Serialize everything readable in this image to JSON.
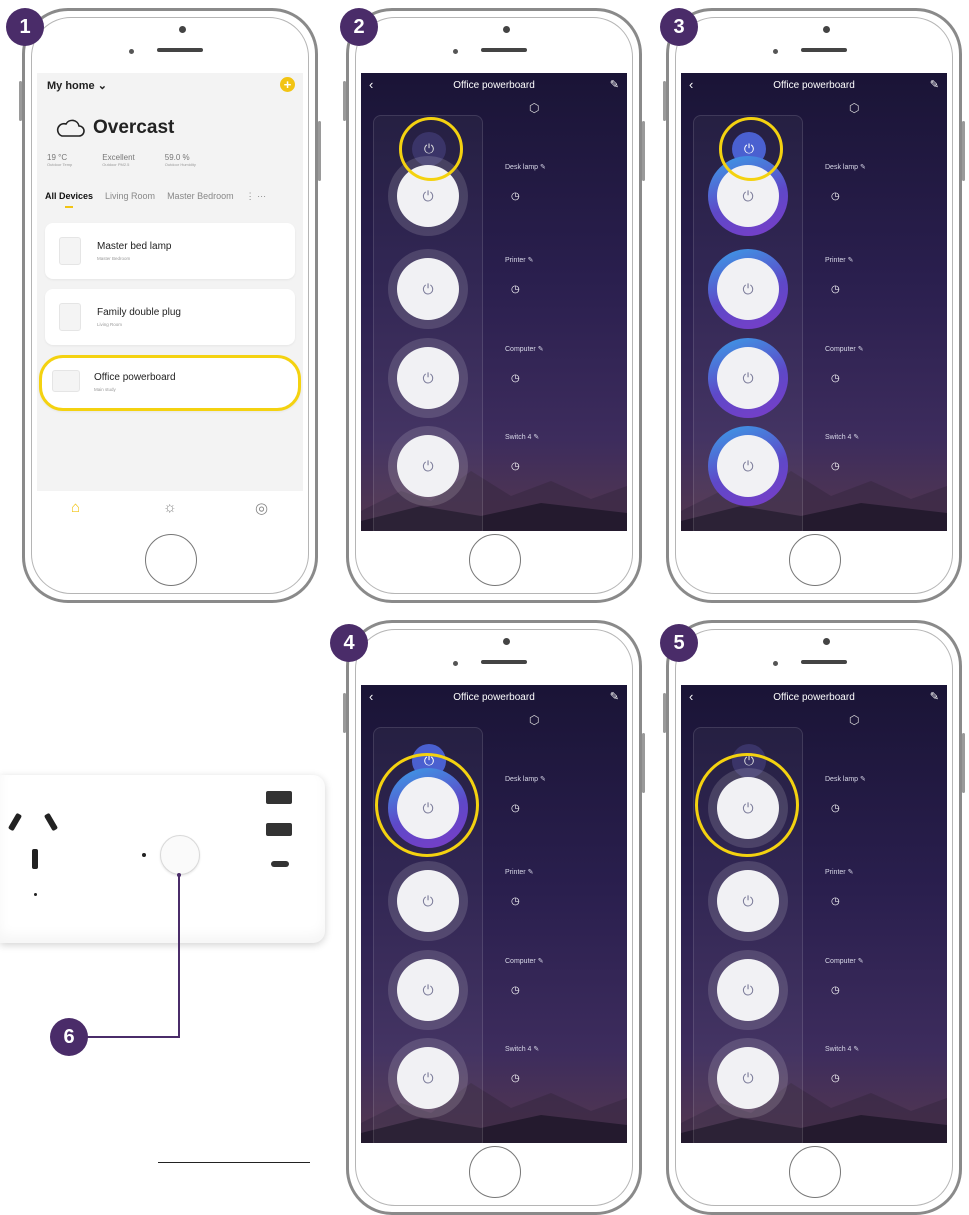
{
  "steps": [
    "1",
    "2",
    "3",
    "4",
    "5",
    "6"
  ],
  "home": {
    "header": "My home",
    "chevron": "⌄",
    "weather": "Overcast",
    "stats": [
      {
        "value": "19 °C",
        "label": "Outdoor Temp"
      },
      {
        "value": "Excellent",
        "label": "Outdoor PM2.5"
      },
      {
        "value": "59.0 %",
        "label": "Outdoor Humidity"
      }
    ],
    "tabs": [
      "All Devices",
      "Living Room",
      "Master Bedroom",
      "⋮ ···"
    ],
    "devices": [
      {
        "name": "Master bed lamp",
        "room": "Master Bedroom"
      },
      {
        "name": "Family double plug",
        "room": "Living Room"
      },
      {
        "name": "Office powerboard",
        "room": "Main study"
      }
    ]
  },
  "board_screen": {
    "back": "‹",
    "title": "Office powerboard",
    "edit": "✎",
    "sockets": [
      "Desk lamp",
      "Printer",
      "Computer",
      "Switch 4"
    ],
    "power_symbol": "⏻",
    "clock_symbol": "◷"
  },
  "states": {
    "s2": {
      "master": false,
      "sockets": [
        false,
        false,
        false,
        false
      ]
    },
    "s3": {
      "master": true,
      "sockets": [
        true,
        true,
        true,
        true
      ]
    },
    "s4": {
      "master": true,
      "sockets": [
        true,
        false,
        false,
        false
      ]
    },
    "s5": {
      "master": false,
      "sockets": [
        false,
        false,
        false,
        false
      ]
    }
  },
  "colors": {
    "step": "#4a2c69",
    "highlight": "#f4d210",
    "accent": "#f2c413",
    "on": "#4a60d0"
  }
}
